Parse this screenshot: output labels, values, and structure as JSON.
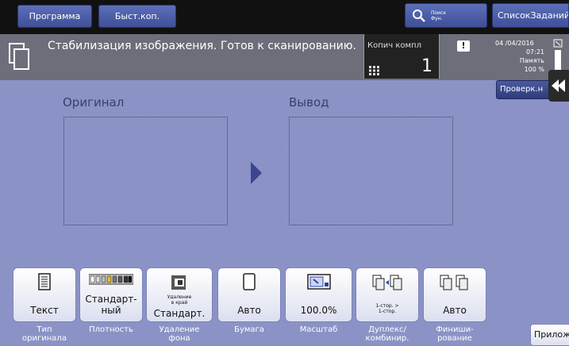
{
  "topbar": {
    "program_label": "Программа",
    "quick_copy_label": "Быст.коп.",
    "search_label_line1": "Поиск",
    "search_label_line2": "Фун.",
    "job_list_label": "СписокЗаданий"
  },
  "status": {
    "message": "Стабилизация изображения. Готов к сканированию.",
    "copies_label": "Копич компл",
    "copies_value": "1",
    "date": "04 /04/2016",
    "time": "07:21",
    "memory_label": "Память",
    "memory_value": "100 %"
  },
  "side": {
    "check_label": "Проверк.н"
  },
  "main": {
    "original_title": "Оригинал",
    "output_title": "Вывод"
  },
  "function_keys": [
    {
      "value": "Текст",
      "caption1": "Тип",
      "caption2": "оригинала"
    },
    {
      "value1": "Стандарт-",
      "value2": "ный",
      "caption1": "Плотность",
      "caption2": ""
    },
    {
      "small1": "Удаление",
      "small2": "в край",
      "value": "Стандарт.",
      "caption1": "Удаление",
      "caption2": "фона"
    },
    {
      "value": "Авто",
      "caption1": "Бумага",
      "caption2": ""
    },
    {
      "value": "100.0%",
      "caption1": "Масштаб",
      "caption2": ""
    },
    {
      "small1": "1-стор. >",
      "small2": "1-стор.",
      "caption1": "Дуплекс/",
      "caption2": "комбинир."
    },
    {
      "value": "Авто",
      "caption1": "Финиши-",
      "caption2": "рование"
    }
  ],
  "apps_label": "Приложение",
  "colors": {
    "background": "#8b93c6",
    "topbar": "#111111",
    "status": "#6c6f7a",
    "button_blue": "#4a5aa8"
  }
}
